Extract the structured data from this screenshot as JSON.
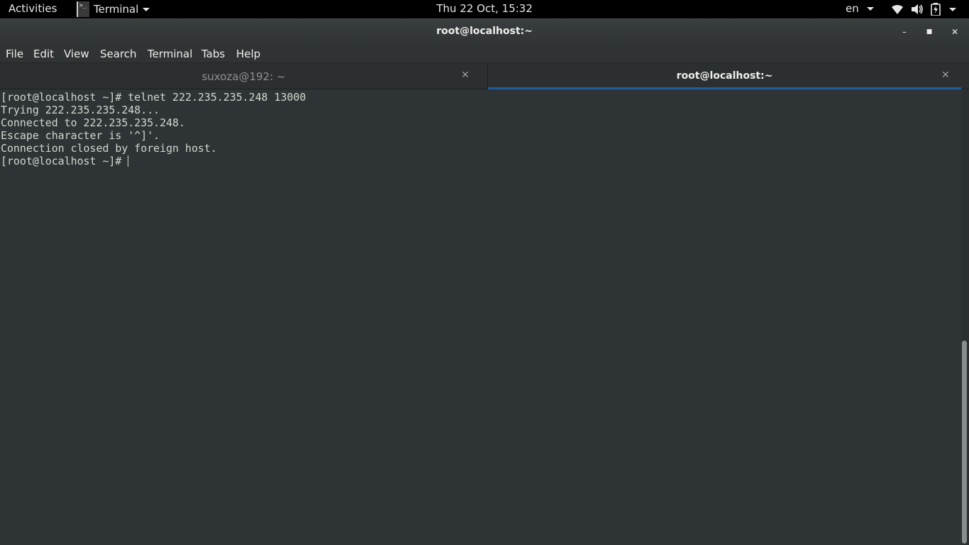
{
  "topbar": {
    "activities": "Activities",
    "app_menu": "Terminal",
    "clock": "Thu 22 Oct, 15:32",
    "lang": "en",
    "tray_icons": [
      "wifi-icon",
      "volume-icon",
      "battery-icon",
      "system-menu-caret-icon"
    ]
  },
  "window": {
    "title": "root@localhost:~",
    "minimize": "–",
    "maximize": "■",
    "close": "✕"
  },
  "menubar": {
    "items": [
      "File",
      "Edit",
      "View",
      "Search",
      "Terminal",
      "Tabs",
      "Help"
    ]
  },
  "tabs": [
    {
      "label": "suxoza@192: ~",
      "close": "✕",
      "active": false
    },
    {
      "label": "root@localhost:~",
      "close": "✕",
      "active": true
    }
  ],
  "terminal": {
    "lines": [
      "[root@localhost ~]# telnet 222.235.235.248 13000",
      "Trying 222.235.235.248...",
      "Connected to 222.235.235.248.",
      "Escape character is '^]'.",
      "Connection closed by foreign host.",
      "[root@localhost ~]# "
    ]
  },
  "colors": {
    "accent": "#215d9c",
    "terminal_bg": "#2e3436",
    "terminal_fg": "#d3d7cf"
  }
}
